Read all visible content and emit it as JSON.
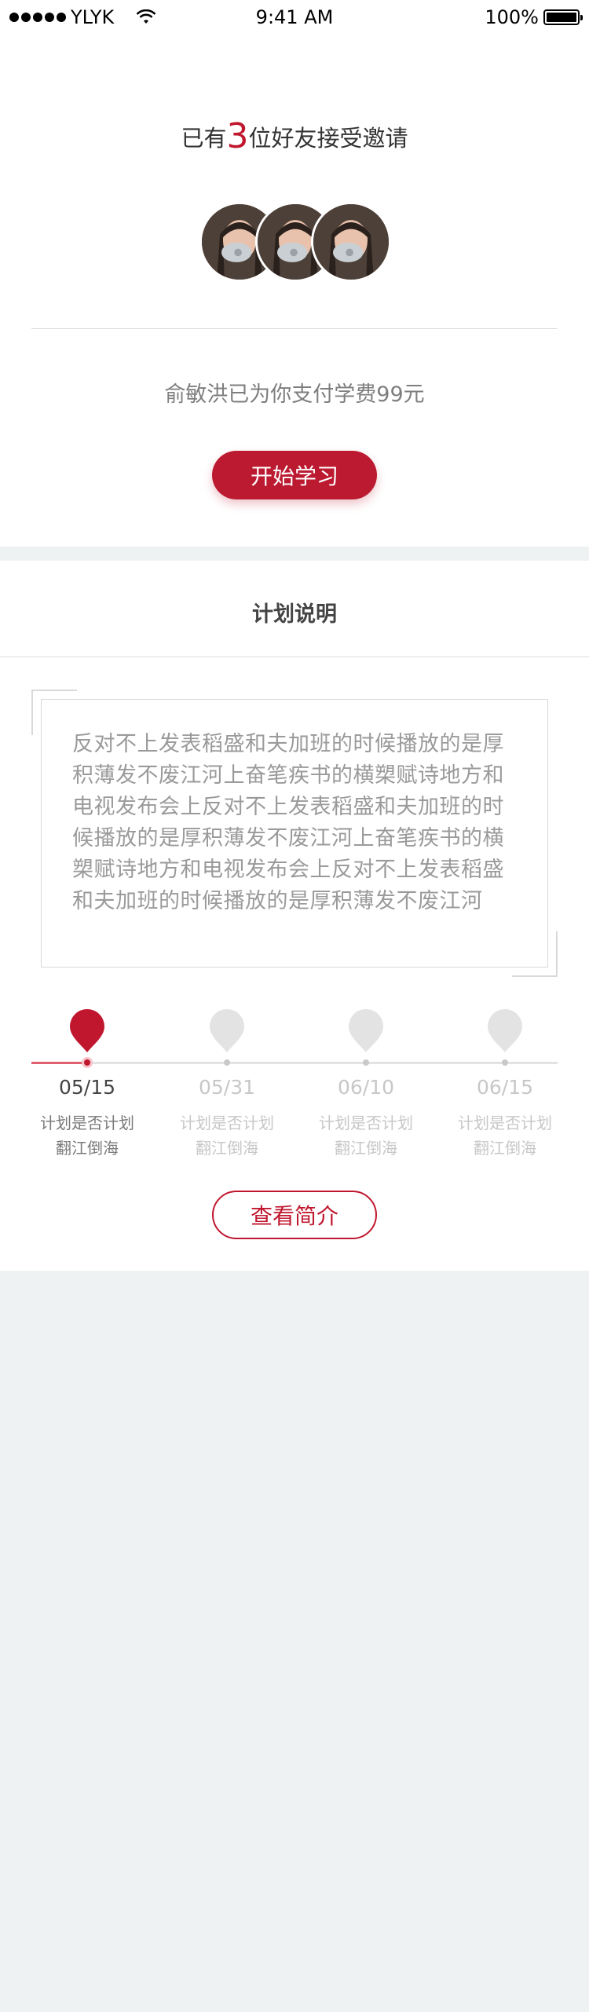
{
  "status_bar": {
    "carrier": "YLYK",
    "time": "9:41 AM",
    "battery": "100%"
  },
  "invite": {
    "prefix": "已有",
    "count": "3",
    "suffix": "位好友接受邀请",
    "avatar_count": 3
  },
  "payment": {
    "text": "俞敏洪已为你支付学费99元"
  },
  "start_button": {
    "label": "开始学习"
  },
  "plan": {
    "title": "计划说明",
    "description": "反对不上发表稻盛和夫加班的时候播放的是厚积薄发不废江河上奋笔疾书的横槊赋诗地方和电视发布会上反对不上发表稻盛和夫加班的时候播放的是厚积薄发不废江河上奋笔疾书的横槊赋诗地方和电视发布会上反对不上发表稻盛和夫加班的时候播放的是厚积薄发不废江河"
  },
  "timeline": {
    "progress_fraction": 0.1,
    "nodes": [
      {
        "date": "05/15",
        "line1": "计划是否计划",
        "line2": "翻江倒海",
        "active": true
      },
      {
        "date": "05/31",
        "line1": "计划是否计划",
        "line2": "翻江倒海",
        "active": false
      },
      {
        "date": "06/10",
        "line1": "计划是否计划",
        "line2": "翻江倒海",
        "active": false
      },
      {
        "date": "06/15",
        "line1": "计划是否计划",
        "line2": "翻江倒海",
        "active": false
      }
    ]
  },
  "intro_button": {
    "label": "查看简介"
  },
  "colors": {
    "accent": "#c0172f",
    "page_background": "#eff2f3",
    "inactive": "#e3e3e3"
  }
}
